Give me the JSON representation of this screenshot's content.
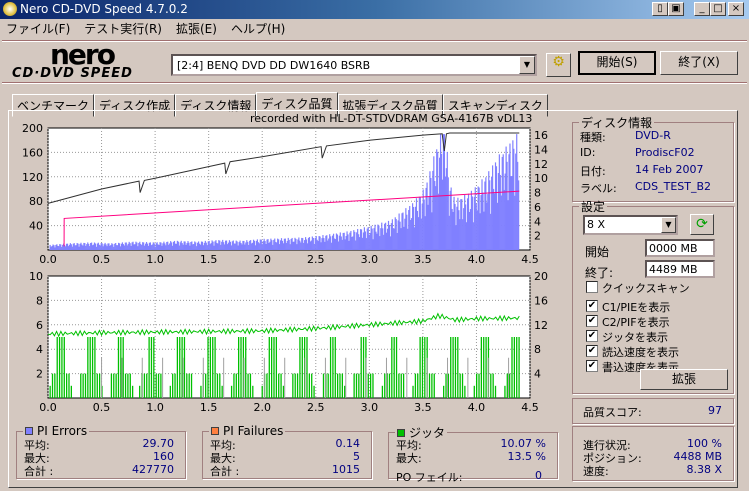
{
  "window": {
    "title": "Nero CD-DVD Speed 4.7.0.2"
  },
  "menu": [
    "ファイル(F)",
    "テスト実行(R)",
    "拡張(E)",
    "ヘルプ(H)"
  ],
  "logo": {
    "top": "nero",
    "bottom": "CD·DVD SPEED"
  },
  "drive": "[2:4]   BENQ DVD DD DW1640 BSRB",
  "buttons": {
    "start": "開始(S)",
    "end": "終了(X)",
    "ext": "拡張"
  },
  "tabs": [
    "ベンチマーク",
    "ディスク作成",
    "ディスク情報",
    "ディスク品質",
    "拡張ディスク品質",
    "スキャンディスク"
  ],
  "chart_caption": "recorded with HL-DT-STDVDRAM GSA-4167B vDL13",
  "disc": {
    "title": "ディスク情報",
    "rows": [
      {
        "k": "種類:",
        "v": "DVD-R"
      },
      {
        "k": "ID:",
        "v": "ProdiscF02"
      },
      {
        "k": "日付:",
        "v": "14 Feb 2007"
      },
      {
        "k": "ラベル:",
        "v": "CDS_TEST_B2"
      }
    ]
  },
  "settings": {
    "title": "設定",
    "speed": "8 X",
    "start_label": "開始",
    "start": "0000 MB",
    "end_label": "終了:",
    "end": "4489 MB",
    "checks": [
      {
        "l": "クイックスキャン",
        "c": false
      },
      {
        "l": "C1/PIEを表示",
        "c": true
      },
      {
        "l": "C2/PIFを表示",
        "c": true
      },
      {
        "l": "ジッタを表示",
        "c": true
      },
      {
        "l": "読込速度を表示",
        "c": true
      },
      {
        "l": "書込速度を表示",
        "c": true
      }
    ]
  },
  "quality": {
    "label": "品質スコア:",
    "value": "97"
  },
  "pie": {
    "title": "PI Errors",
    "color": "#8080ff",
    "avg_l": "平均:",
    "avg": "29.70",
    "max_l": "最大:",
    "max": "160",
    "tot_l": "合計 :",
    "tot": "427770"
  },
  "pif": {
    "title": "PI Failures",
    "color": "#ff8040",
    "avg_l": "平均:",
    "avg": "0.14",
    "max_l": "最大:",
    "max": "5",
    "tot_l": "合計 :",
    "tot": "1015"
  },
  "jit": {
    "title": "ジッタ",
    "color": "#00c000",
    "avg_l": "平均:",
    "avg": "10.07 %",
    "max_l": "最大:",
    "max": "13.5 %",
    "po_l": "PO フェイル:",
    "po": "0"
  },
  "progress": {
    "p_l": "進行状況:",
    "p": "100 %",
    "pos_l": "ポジション:",
    "pos": "4488 MB",
    "spd_l": "速度:",
    "spd": "8.38 X"
  },
  "chart_data": [
    {
      "type": "bar",
      "title": "PI Errors / Speed",
      "xlim": [
        0,
        4.5
      ],
      "ylim": [
        0,
        200
      ],
      "y2lim": [
        0,
        17
      ],
      "xticks": [
        "0.0",
        "0.5",
        "1.0",
        "1.5",
        "2.0",
        "2.5",
        "3.0",
        "3.5",
        "4.0",
        "4.5"
      ],
      "yticks": [
        "200",
        "160",
        "120",
        "80",
        "40"
      ],
      "y2ticks": [
        "16",
        "14",
        "12",
        "10",
        "8",
        "6",
        "4",
        "2"
      ],
      "pie_x": [
        0,
        0.2,
        0.4,
        0.6,
        0.8,
        1.0,
        1.2,
        1.4,
        1.6,
        1.8,
        2.0,
        2.2,
        2.4,
        2.6,
        2.8,
        3.0,
        3.2,
        3.3,
        3.4,
        3.5,
        3.55,
        3.6,
        3.65,
        3.7,
        3.75,
        3.8,
        3.9,
        4.0,
        4.1,
        4.2,
        4.3,
        4.4
      ],
      "pie_y": [
        6,
        8,
        9,
        8,
        10,
        9,
        11,
        10,
        12,
        11,
        13,
        14,
        15,
        18,
        22,
        28,
        35,
        45,
        55,
        70,
        85,
        110,
        130,
        160,
        80,
        60,
        65,
        75,
        90,
        110,
        125,
        140
      ],
      "read_x": [
        0,
        0.5,
        0.85,
        0.86,
        0.9,
        1.0,
        1.65,
        1.66,
        1.7,
        2.0,
        2.55,
        2.56,
        2.6,
        3.0,
        3.5,
        3.68,
        3.7,
        3.72,
        3.75,
        4.0,
        4.4
      ],
      "read_y": [
        6.5,
        8.5,
        9.6,
        8.0,
        9.7,
        10,
        12.1,
        10.6,
        12.3,
        13,
        14.4,
        12.8,
        14.5,
        15.3,
        16,
        16.2,
        13.8,
        16.2,
        16.3,
        16.3,
        16.3
      ],
      "write_x": [
        0.15,
        0.151,
        4.4
      ],
      "write_y": [
        0.5,
        4.4,
        8.2
      ]
    },
    {
      "type": "bar",
      "title": "PI Failures / Jitter",
      "xlim": [
        0,
        4.5
      ],
      "ylim": [
        0,
        10
      ],
      "y2lim": [
        0,
        20
      ],
      "xticks": [
        "0.0",
        "0.5",
        "1.0",
        "1.5",
        "2.0",
        "2.5",
        "3.0",
        "3.5",
        "4.0",
        "4.5"
      ],
      "yticks": [
        "10",
        "8",
        "6",
        "4",
        "2"
      ],
      "y2ticks": [
        "20",
        "16",
        "12",
        "8",
        "4"
      ],
      "jitter_x": [
        0,
        0.5,
        1.0,
        1.5,
        2.0,
        2.5,
        3.0,
        3.5,
        3.65,
        3.8,
        4.0,
        4.4
      ],
      "jitter_y": [
        10.5,
        10.7,
        10.8,
        10.9,
        11.0,
        11.4,
        12.0,
        12.6,
        13.5,
        12.8,
        13.0,
        13.1
      ]
    }
  ]
}
